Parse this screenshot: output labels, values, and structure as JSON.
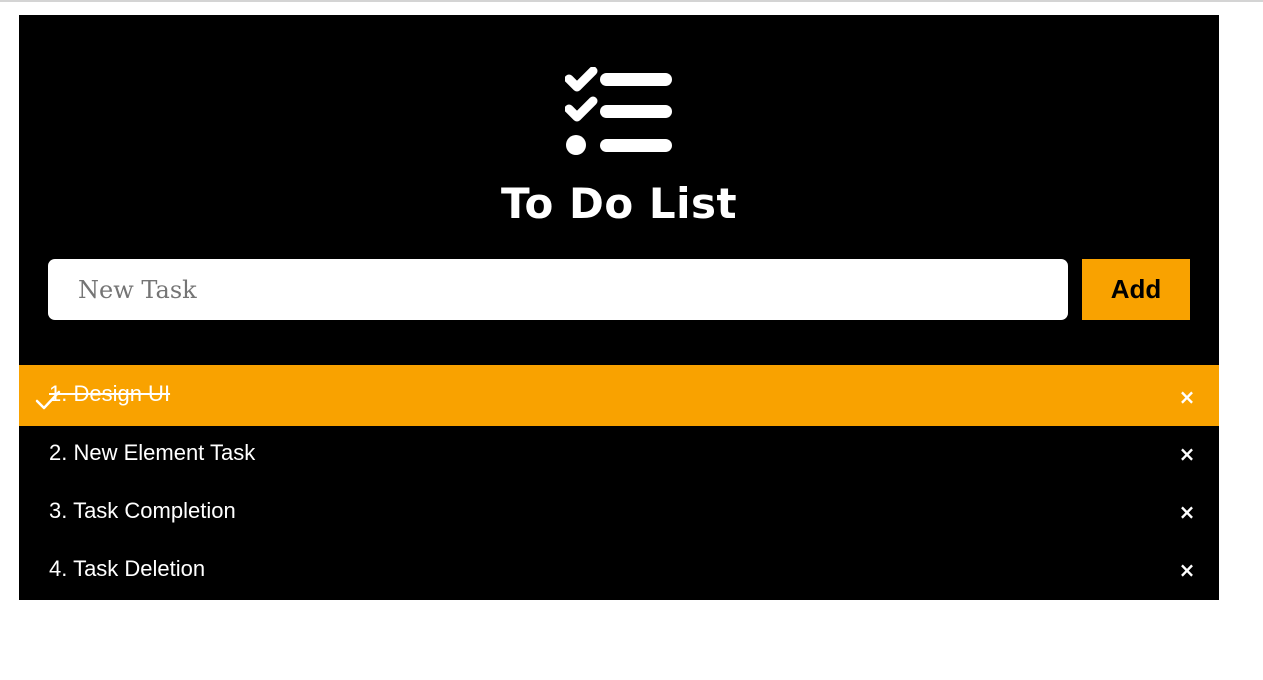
{
  "app": {
    "title": "To Do List",
    "logo_icon": "checklist-icon"
  },
  "input": {
    "placeholder": "New Task",
    "value": ""
  },
  "add_button": {
    "label": "Add"
  },
  "colors": {
    "background": "#000000",
    "accent": "#f9a200",
    "text": "#ffffff"
  },
  "tasks": [
    {
      "label": "1. Design UI",
      "completed": true,
      "delete_icon": "×"
    },
    {
      "label": "2. New Element Task",
      "completed": false,
      "delete_icon": "×"
    },
    {
      "label": "3. Task Completion",
      "completed": false,
      "delete_icon": "×"
    },
    {
      "label": "4. Task Deletion",
      "completed": false,
      "delete_icon": "×"
    }
  ]
}
